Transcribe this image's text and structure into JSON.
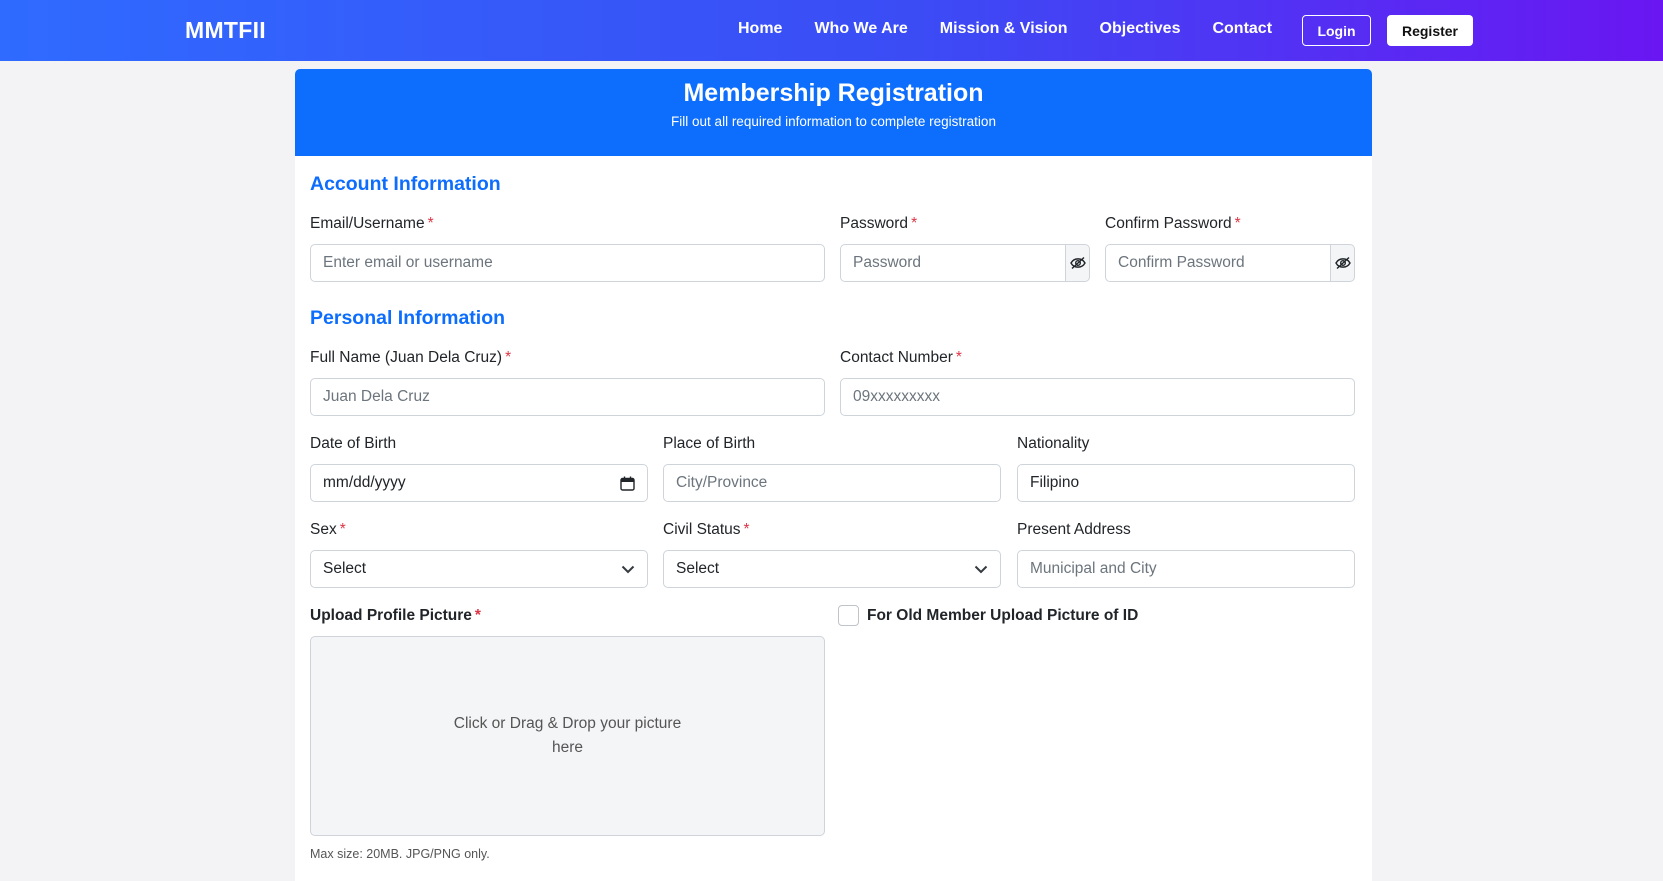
{
  "nav": {
    "brand": "MMTFII",
    "links": [
      "Home",
      "Who We Are",
      "Mission & Vision",
      "Objectives",
      "Contact"
    ],
    "login": "Login",
    "register": "Register"
  },
  "form": {
    "title": "Membership Registration",
    "subtitle": "Fill out all required information to complete registration",
    "account_section": "Account Information",
    "personal_section": "Personal Information",
    "required_mark": "*",
    "email": {
      "label": "Email/Username",
      "placeholder": "Enter email or username"
    },
    "password": {
      "label": "Password",
      "placeholder": "Password"
    },
    "confirm_password": {
      "label": "Confirm Password",
      "placeholder": "Confirm Password"
    },
    "full_name": {
      "label": "Full Name (Juan Dela Cruz)",
      "placeholder": "Juan Dela Cruz"
    },
    "contact": {
      "label": "Contact Number",
      "placeholder": "09xxxxxxxxx"
    },
    "dob": {
      "label": "Date of Birth",
      "value": "mm/dd/yyyy"
    },
    "pob": {
      "label": "Place of Birth",
      "placeholder": "City/Province"
    },
    "nationality": {
      "label": "Nationality",
      "value": "Filipino"
    },
    "sex": {
      "label": "Sex",
      "value": "Select"
    },
    "civil_status": {
      "label": "Civil Status",
      "value": "Select"
    },
    "address": {
      "label": "Present Address",
      "placeholder": "Municipal and City"
    },
    "upload": {
      "label": "Upload Profile Picture",
      "dropzone_text": "Click or Drag & Drop your picture here",
      "hint": "Max size: 20MB. JPG/PNG only."
    },
    "old_member": {
      "label": "For Old Member Upload Picture of ID",
      "checked": false
    }
  },
  "icons": {
    "eye": "eye-slash-icon",
    "calendar": "calendar-icon",
    "chevron": "chevron-down-icon"
  },
  "colors": {
    "primary": "#0d6efd",
    "required": "#dc3545",
    "nav_start": "#2f6bff",
    "nav_end": "#6a16f2"
  }
}
